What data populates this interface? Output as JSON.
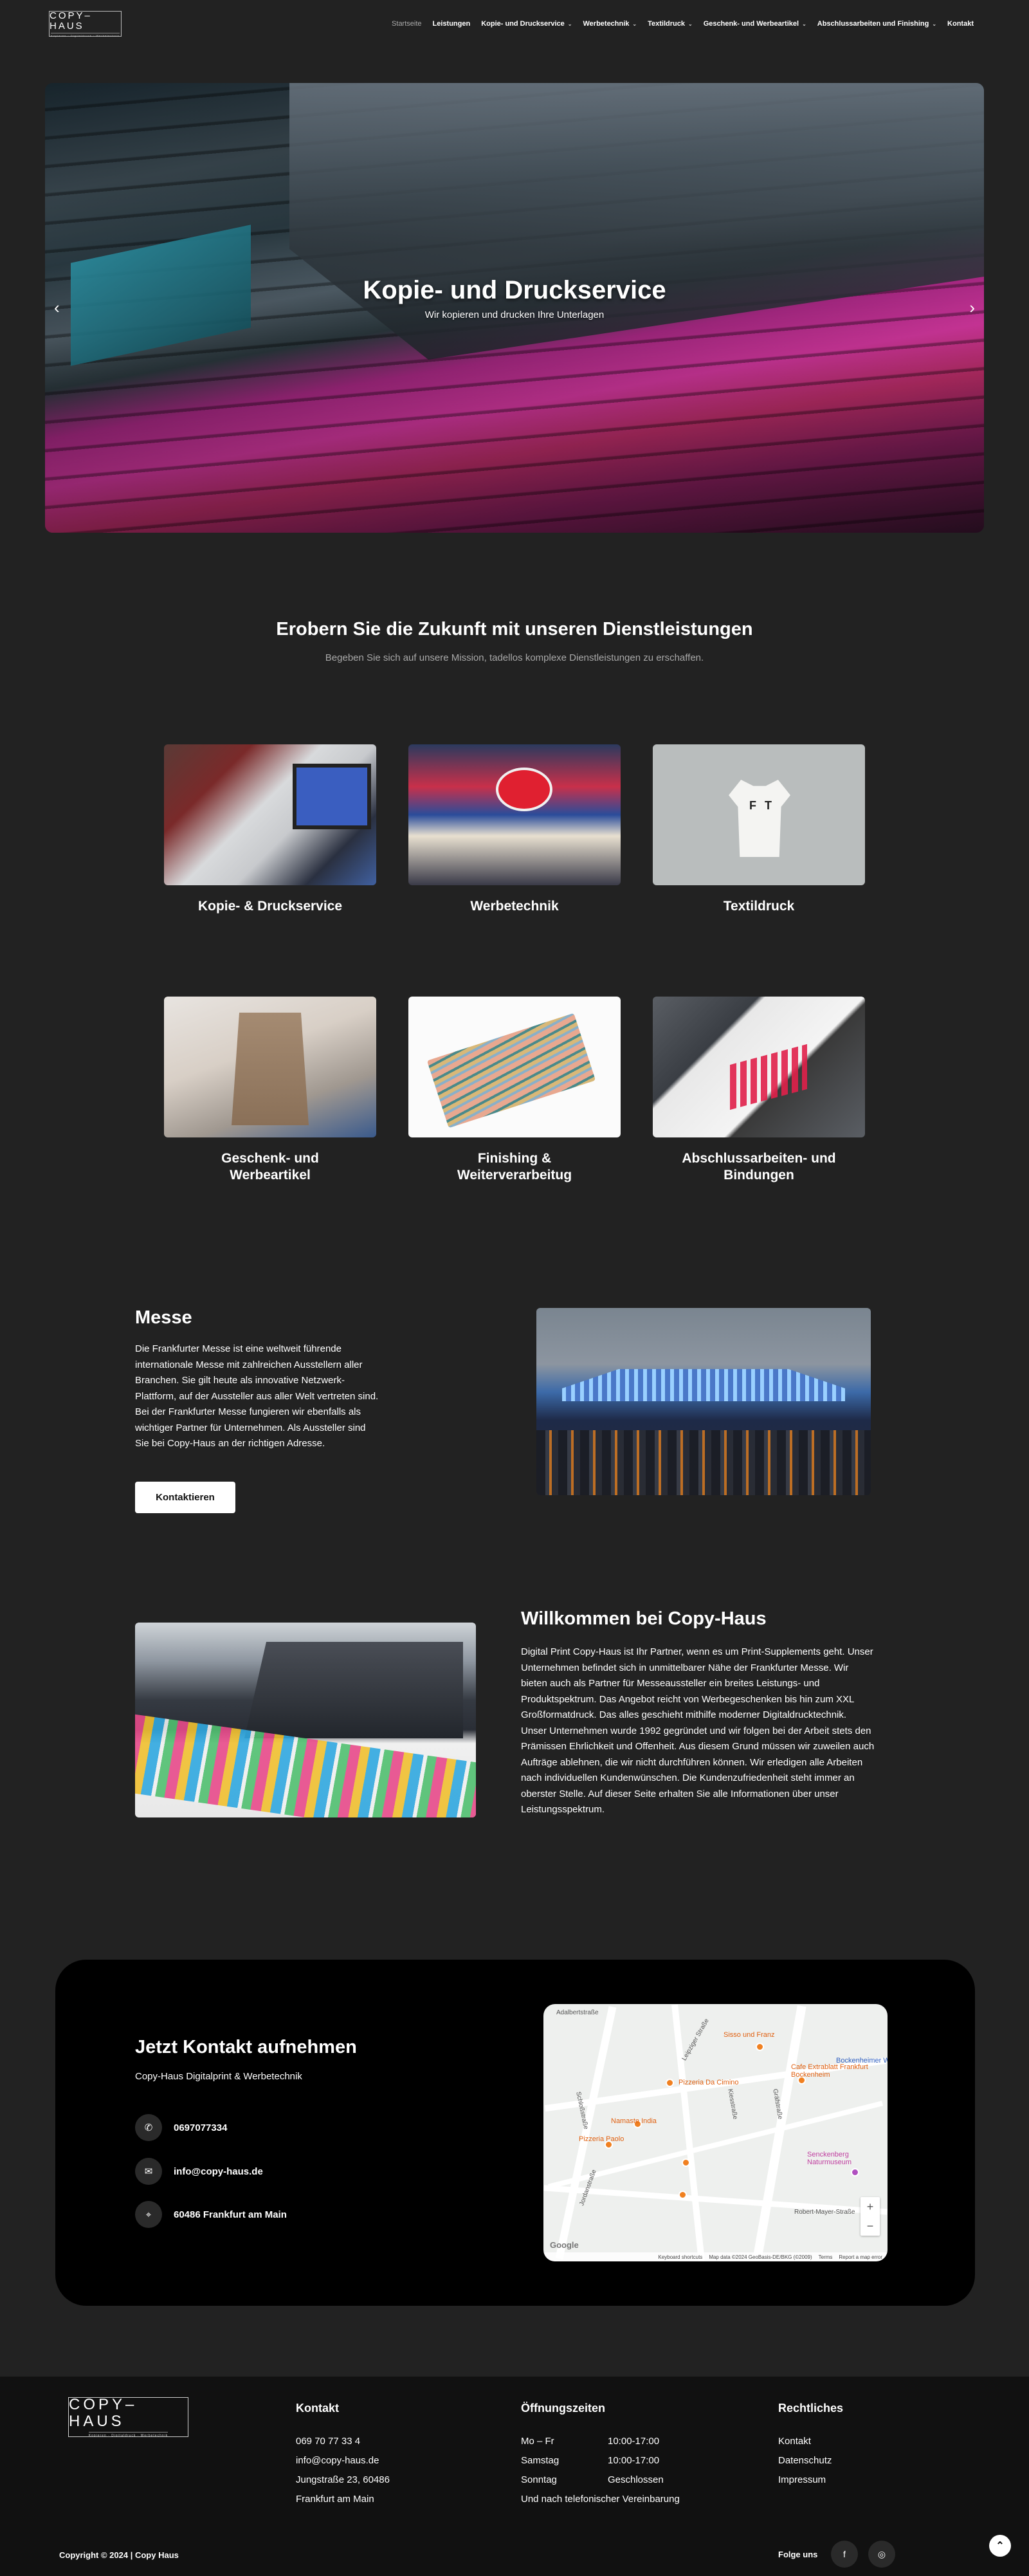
{
  "brand": {
    "logo_text": "COPY–HAUS",
    "logo_tagline": "Kopieren · Digitaldruck · Werbetechnik"
  },
  "nav": {
    "items": [
      {
        "label": "Startseite",
        "active": true,
        "dropdown": false
      },
      {
        "label": "Leistungen",
        "active": false,
        "dropdown": false
      },
      {
        "label": "Kopie- und Druckservice",
        "active": false,
        "dropdown": true
      },
      {
        "label": "Werbetechnik",
        "active": false,
        "dropdown": true
      },
      {
        "label": "Textildruck",
        "active": false,
        "dropdown": true
      },
      {
        "label": "Geschenk- und Werbeartikel",
        "active": false,
        "dropdown": true
      },
      {
        "label": "Abschlussarbeiten und Finishing",
        "active": false,
        "dropdown": true
      },
      {
        "label": "Kontakt",
        "active": false,
        "dropdown": false
      }
    ]
  },
  "hero": {
    "title": "Kopie- und Druckservice",
    "subtitle": "Wir kopieren und drucken Ihre Unterlagen",
    "prev_icon": "‹",
    "next_icon": "›"
  },
  "services": {
    "title": "Erobern Sie die Zukunft mit unseren Dienstleistungen",
    "subtitle": "Begeben Sie sich auf unsere Mission, tadellos komplexe Dienstleistungen zu erschaffen.",
    "cards": [
      {
        "label": "Kopie- & Druckservice"
      },
      {
        "label": "Werbetechnik"
      },
      {
        "label": "Textildruck"
      },
      {
        "label": "Geschenk- und Werbeartikel"
      },
      {
        "label": "Finishing & Weiterverarbeitug"
      },
      {
        "label": "Abschlussarbeiten- und Bindungen"
      }
    ]
  },
  "messe": {
    "title": "Messe",
    "text": "Die Frankfurter Messe ist eine weltweit führende internationale Messe mit zahlreichen Ausstellern aller Branchen. Sie gilt heute als innovative Netzwerk-Plattform, auf der Aussteller aus aller Welt vertreten sind. Bei der Frankfurter Messe fungieren wir ebenfalls als wichtiger Partner für Unternehmen. Als Aussteller sind Sie bei Copy-Haus an der richtigen Adresse.",
    "button": "Kontaktieren"
  },
  "welcome": {
    "title": "Willkommen bei Copy-Haus",
    "text": "Digital Print Copy-Haus ist Ihr Partner, wenn es um Print-Supplements geht. Unser Unternehmen befindet sich in unmittelbarer Nähe der Frankfurter Messe. Wir bieten auch als Partner für Messeaussteller ein breites Leistungs- und Produktspektrum. Das Angebot reicht von Werbegeschenken bis hin zum XXL Großformatdruck. Das alles geschieht mithilfe moderner Digitaldrucktechnik. Unser Unternehmen wurde 1992 gegründet und wir folgen bei der Arbeit stets den Prämissen Ehrlichkeit und Offenheit. Aus diesem Grund müssen wir zuweilen auch Aufträge ablehnen, die wir nicht durchführen können. Wir erledigen alle Arbeiten nach individuellen Kundenwünschen. Die Kundenzufriedenheit steht immer an oberster Stelle. Auf dieser Seite erhalten Sie alle Informationen über unser Leistungsspektrum."
  },
  "contact": {
    "title": "Jetzt Kontakt aufnehmen",
    "subtitle": "Copy-Haus Digitalprint & Werbetechnik",
    "phone": "0697077334",
    "email": "info@copy-haus.de",
    "address": "60486 Frankfurt am Main",
    "map": {
      "streets": [
        "Schloßstraße",
        "Leipziger Straße",
        "Kiesstraße",
        "Robert-Mayer-Straße",
        "Gräfstraße",
        "Adalbertstraße",
        "Jordanstraße"
      ],
      "pois": [
        "Sisso und Franz",
        "Pizzeria Da Cimino",
        "Cafe Extrablatt Frankfurt Bockenheim",
        "Namaste India",
        "Pizzeria Paolo",
        "Senckenberg Naturmuseum",
        "Bockenheimer Warte"
      ],
      "footer": [
        "Keyboard shortcuts",
        "Map data ©2024 GeoBasis-DE/BKG (©2009)",
        "Terms",
        "Report a map error"
      ],
      "google": "Google"
    }
  },
  "footer": {
    "kontakt": {
      "title": "Kontakt",
      "lines": [
        "069 70 77 33 4",
        "info@copy-haus.de",
        "Jungstraße 23, 60486",
        "Frankfurt am Main"
      ]
    },
    "hours": {
      "title": "Öffnungszeiten",
      "rows": [
        {
          "day": "Mo – Fr",
          "time": "10:00-17:00"
        },
        {
          "day": "Samstag",
          "time": "10:00-17:00"
        },
        {
          "day": "Sonntag",
          "time": "Geschlossen"
        }
      ],
      "note": "Und nach telefonischer Vereinbarung"
    },
    "legal": {
      "title": "Rechtliches",
      "links": [
        "Kontakt",
        "Datenschutz",
        "Impressum"
      ]
    },
    "copyright": "Copyright © 2024 | Copy Haus",
    "follow": "Folge uns"
  }
}
